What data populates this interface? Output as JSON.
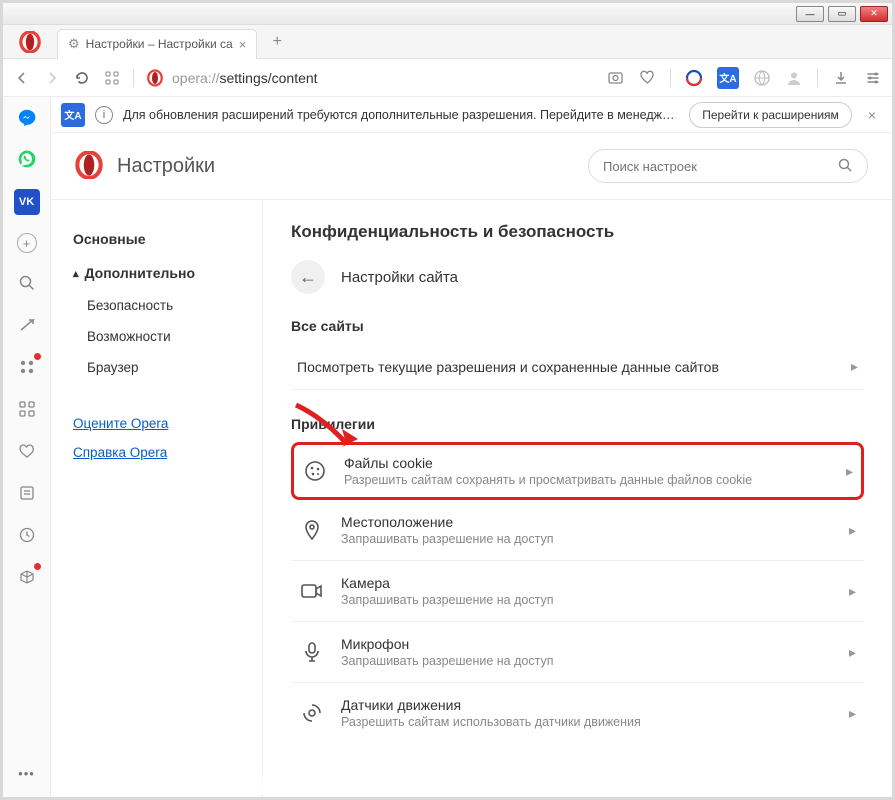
{
  "tab": {
    "title": "Настройки – Настройки са"
  },
  "url": {
    "scheme": "opera://",
    "path": "settings/content"
  },
  "notif": {
    "text": "Для обновления расширений требуются дополнительные разрешения. Перейдите в менеджер р...",
    "button": "Перейти к расширениям"
  },
  "header": {
    "title": "Настройки",
    "search_placeholder": "Поиск настроек"
  },
  "nav": {
    "basic": "Основные",
    "advanced": "Дополнительно",
    "security": "Безопасность",
    "features": "Возможности",
    "browser": "Браузер",
    "rate": "Оцените Opera",
    "help": "Справка Opera"
  },
  "main": {
    "section": "Конфиденциальность и безопасность",
    "back_label": "Настройки сайта",
    "all_sites": "Все сайты",
    "view_perms": "Посмотреть текущие разрешения и сохраненные данные сайтов",
    "privileges": "Привилегии",
    "cookies": {
      "title": "Файлы cookie",
      "sub": "Разрешить сайтам сохранять и просматривать данные файлов cookie"
    },
    "location": {
      "title": "Местоположение",
      "sub": "Запрашивать разрешение на доступ"
    },
    "camera": {
      "title": "Камера",
      "sub": "Запрашивать разрешение на доступ"
    },
    "mic": {
      "title": "Микрофон",
      "sub": "Запрашивать разрешение на доступ"
    },
    "motion": {
      "title": "Датчики движения",
      "sub": "Разрешить сайтам использовать датчики движения"
    }
  }
}
